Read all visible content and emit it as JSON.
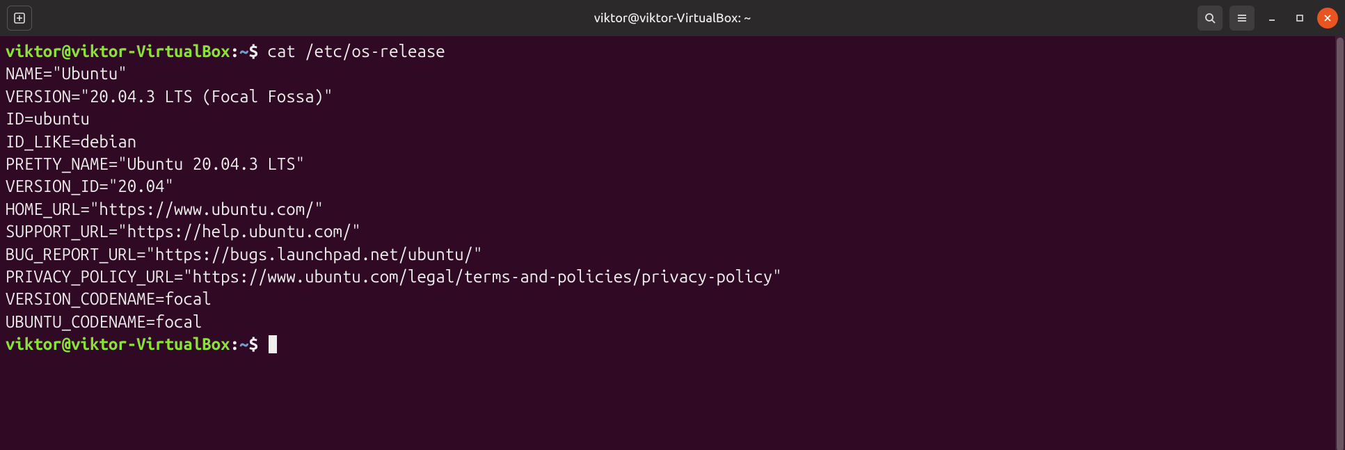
{
  "window": {
    "title": "viktor@viktor-VirtualBox: ~"
  },
  "prompt": {
    "userhost": "viktor@viktor-VirtualBox",
    "sep": ":",
    "path": "~",
    "symbol": "$"
  },
  "command": "cat /etc/os-release",
  "output_lines": [
    "NAME=\"Ubuntu\"",
    "VERSION=\"20.04.3 LTS (Focal Fossa)\"",
    "ID=ubuntu",
    "ID_LIKE=debian",
    "PRETTY_NAME=\"Ubuntu 20.04.3 LTS\"",
    "VERSION_ID=\"20.04\"",
    "HOME_URL=\"https://www.ubuntu.com/\"",
    "SUPPORT_URL=\"https://help.ubuntu.com/\"",
    "BUG_REPORT_URL=\"https://bugs.launchpad.net/ubuntu/\"",
    "PRIVACY_POLICY_URL=\"https://www.ubuntu.com/legal/terms-and-policies/privacy-policy\"",
    "VERSION_CODENAME=focal",
    "UBUNTU_CODENAME=focal"
  ],
  "icons": {
    "new_tab": "new-tab-icon",
    "search": "search-icon",
    "hamburger": "hamburger-menu-icon",
    "minimize": "minimize-icon",
    "maximize": "maximize-icon",
    "close": "close-icon"
  },
  "colors": {
    "titlebar_bg": "#2b2929",
    "terminal_bg": "#300a24",
    "text_default": "#eeeeec",
    "prompt_user": "#8ae234",
    "prompt_path": "#729fcf",
    "close_btn": "#e95420"
  }
}
